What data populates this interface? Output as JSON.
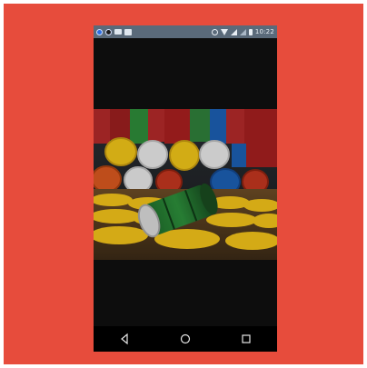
{
  "status_bar": {
    "time": "10:22",
    "left_icons": [
      "app-icon",
      "app-icon-2",
      "message-icon",
      "image-icon"
    ],
    "right_icons": [
      "alarm-icon",
      "wifi-icon",
      "signal-icon",
      "signal-icon-2",
      "battery-icon"
    ]
  },
  "content": {
    "photo": "oil-barrels-photo"
  },
  "nav_bar": {
    "buttons": [
      "back-icon",
      "home-icon",
      "recents-icon"
    ]
  },
  "colors": {
    "frame": "#e74c3c",
    "screen": "#0d0d0d",
    "status_bar": "#5a6a7a",
    "nav_bar": "#000000"
  }
}
